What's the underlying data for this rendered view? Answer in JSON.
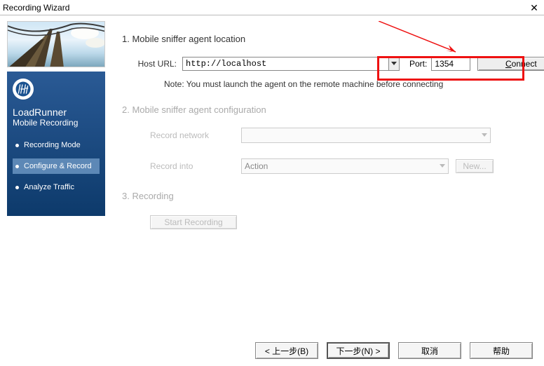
{
  "window": {
    "title": "Recording Wizard"
  },
  "sidebar": {
    "product1": "LoadRunner",
    "product2": "Mobile Recording",
    "items": [
      {
        "label": "Recording Mode"
      },
      {
        "label": "Configure & Record"
      },
      {
        "label": "Analyze Traffic"
      }
    ]
  },
  "steps": {
    "s1_title": "1.   Mobile sniffer agent location",
    "host_label": "Host URL:",
    "host_value": "http://localhost",
    "port_label": "Port:",
    "port_value": "1354",
    "connect_label": "Connect",
    "note": "Note: You must launch the agent on the remote machine before connecting",
    "s2_title": "2.   Mobile sniffer agent configuration",
    "record_network_label": "Record network",
    "record_into_label": "Record into",
    "record_into_value": "Action",
    "new_label": "New...",
    "s3_title": "3.   Recording",
    "start_label": "Start Recording"
  },
  "footer": {
    "back": "< 上一步(B)",
    "next": "下一步(N) >",
    "cancel": "取消",
    "help": "帮助"
  }
}
